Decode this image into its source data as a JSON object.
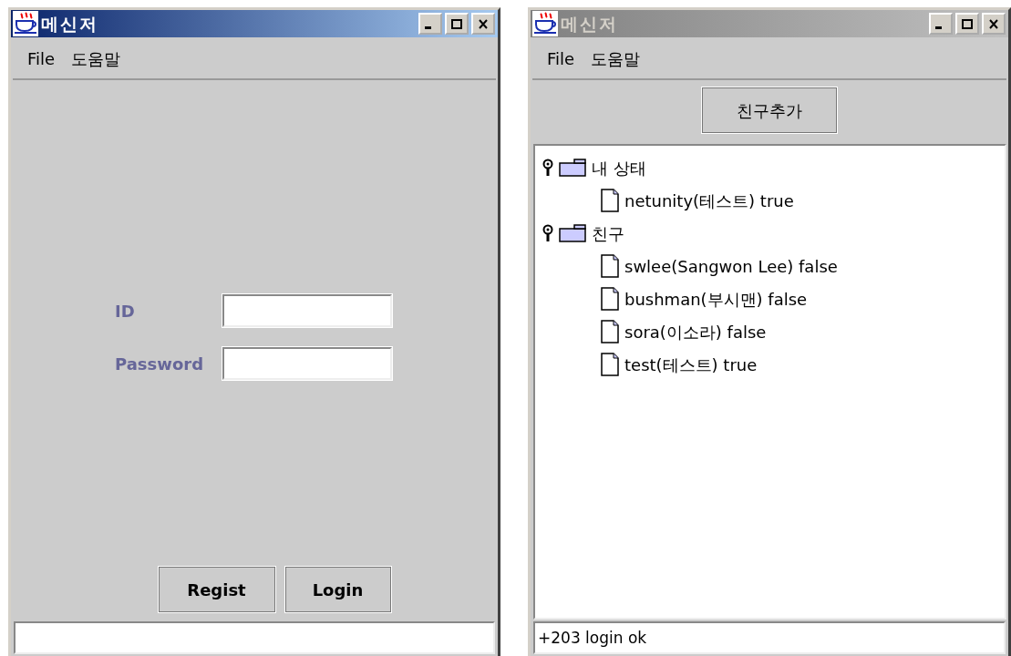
{
  "windows": [
    {
      "kind": "login",
      "title": "메신저",
      "active": true,
      "menu": [
        "File",
        "도움말"
      ],
      "fields": [
        {
          "label": "ID"
        },
        {
          "label": "Password"
        }
      ],
      "buttons": [
        "Regist",
        "Login"
      ]
    },
    {
      "kind": "buddy_list",
      "title": "메신저",
      "active": false,
      "menu": [
        "File",
        "도움말"
      ],
      "add_button": "친구추가",
      "tree": [
        {
          "label": "내 상태",
          "expanded": true,
          "children": [
            {
              "label": "netunity(테스트) true"
            }
          ]
        },
        {
          "label": "친구",
          "expanded": true,
          "children": [
            {
              "label": "swlee(Sangwon Lee) false"
            },
            {
              "label": "bushman(부시맨) false"
            },
            {
              "label": "sora(이소라) false"
            },
            {
              "label": "test(테스트) true"
            }
          ]
        }
      ],
      "status_bar": "+203 login ok"
    }
  ]
}
